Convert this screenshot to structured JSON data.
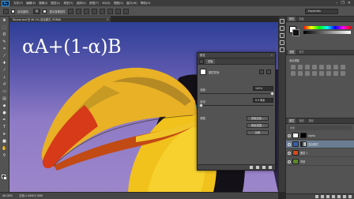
{
  "app": {
    "logo_text": "Ps",
    "menu": [
      "文件(F)",
      "编辑(E)",
      "图像(I)",
      "图层(L)",
      "类型(Y)",
      "选择(S)",
      "滤镜(T)",
      "3D(D)",
      "视图(V)",
      "窗口(W)",
      "帮助(H)"
    ],
    "window_controls": [
      "–",
      "❐",
      "✕"
    ]
  },
  "options_bar": {
    "auto_select_label": "自动选择：",
    "auto_select_value": "组",
    "show_transform_label": "显示变换控件",
    "workspace": "Essentials"
  },
  "document": {
    "tab_title": "Toucan.psd @ 46.1% (混合模式, RGB/8)",
    "overlay_formula": "αA+(1-α)B"
  },
  "status": {
    "zoom": "46.08%",
    "doc_info": "文档:1.45M/2.90M"
  },
  "dialog": {
    "header": "属性",
    "tab": "蒙版",
    "mask_label": "图层蒙版",
    "density_label": "浓度:",
    "density_value": "100%",
    "feather_label": "羽化:",
    "feather_value": "0.0 像素",
    "refine_label": "调整:",
    "buttons": [
      "蒙版边缘...",
      "颜色范围...",
      "反相"
    ]
  },
  "right_panel": {
    "color_tabs": [
      "颜色",
      "色板"
    ],
    "adjust_tabs": [
      "调整",
      "样式"
    ],
    "adjust_hint": "添加调整",
    "layers_tabs": [
      "图层",
      "通道",
      "路径"
    ],
    "layers_filter": "类型",
    "layers": [
      {
        "name": "alpha",
        "selected": false
      },
      {
        "name": "混合模式",
        "selected": true
      },
      {
        "name": "图层 1",
        "selected": false
      },
      {
        "name": "背景",
        "selected": false
      }
    ]
  },
  "icons": {
    "tools": [
      "move-tool",
      "marquee-tool",
      "lasso-tool",
      "quick-select-tool",
      "crop-tool",
      "eyedropper-tool",
      "healing-brush-tool",
      "brush-tool",
      "clone-stamp-tool",
      "history-brush-tool",
      "eraser-tool",
      "gradient-tool",
      "blur-tool",
      "dodge-tool",
      "pen-tool",
      "type-tool",
      "path-select-tool",
      "shape-tool",
      "hand-tool",
      "zoom-tool"
    ]
  },
  "colors": {
    "accent_selected_layer": "#6a7d93",
    "canvas_bg_top": "#2e3f96",
    "canvas_bg_bottom": "#9d86ca",
    "beak_yellow": "#f0b92a",
    "beak_red": "#d83a1a"
  }
}
